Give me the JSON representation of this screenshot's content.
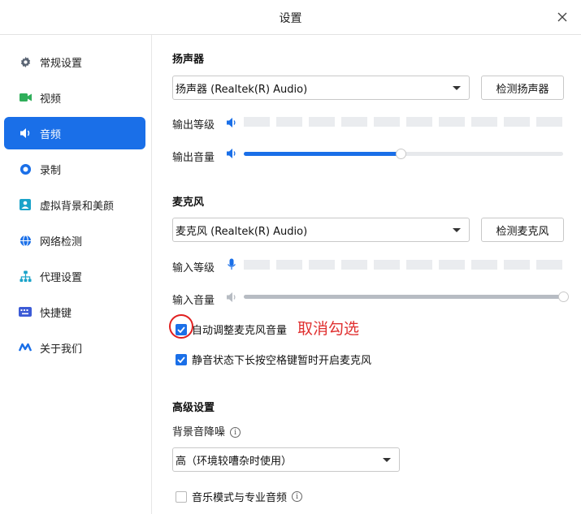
{
  "window": {
    "title": "设置"
  },
  "sidebar": {
    "items": [
      {
        "label": "常规设置",
        "icon": "gear-icon"
      },
      {
        "label": "视频",
        "icon": "video-camera-icon"
      },
      {
        "label": "音频",
        "icon": "speaker-icon",
        "active": true
      },
      {
        "label": "录制",
        "icon": "record-icon"
      },
      {
        "label": "虚拟背景和美颜",
        "icon": "portrait-icon"
      },
      {
        "label": "网络检测",
        "icon": "globe-icon"
      },
      {
        "label": "代理设置",
        "icon": "network-nodes-icon"
      },
      {
        "label": "快捷键",
        "icon": "keyboard-icon"
      },
      {
        "label": "关于我们",
        "icon": "logo-icon"
      }
    ]
  },
  "speaker": {
    "section_title": "扬声器",
    "device": "扬声器 (Realtek(R) Audio)",
    "test_button": "检测扬声器",
    "output_level_label": "输出等级",
    "output_volume_label": "输出音量",
    "output_volume_value": 0.49
  },
  "mic": {
    "section_title": "麦克风",
    "device": "麦克风 (Realtek(R) Audio)",
    "test_button": "检测麦克风",
    "input_level_label": "输入等级",
    "input_volume_label": "输入音量",
    "input_volume_value": 1.0,
    "auto_adjust_label": "自动调整麦克风音量",
    "auto_adjust_checked": true,
    "mute_space_label": "静音状态下长按空格键暂时开启麦克风",
    "mute_space_checked": true
  },
  "annotation": {
    "text": "取消勾选",
    "color": "#e03030"
  },
  "advanced": {
    "section_title": "高级设置",
    "noise_label": "背景音降噪",
    "noise_value": "高（环境较嘈杂时使用）",
    "music_mode_label": "音乐模式与专业音频",
    "music_mode_checked": false
  },
  "colors": {
    "accent": "#1a6fe8",
    "annotation": "#e03030"
  }
}
